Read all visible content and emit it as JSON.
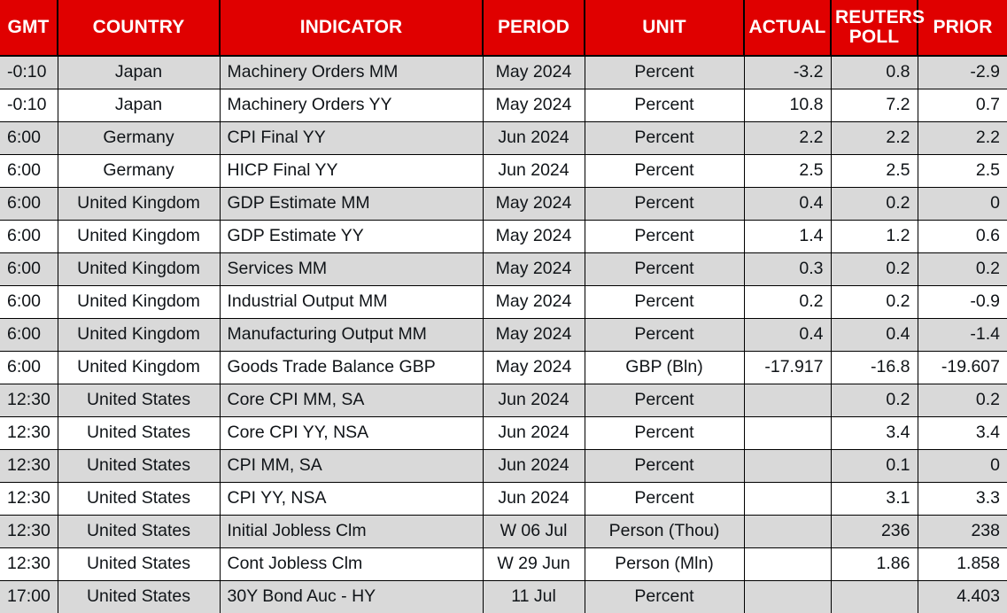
{
  "table": {
    "accent_color": "#e00000",
    "header_text_color": "#ffffff",
    "shaded_row_color": "#d9d9d9",
    "plain_row_color": "#ffffff",
    "columns": [
      {
        "key": "gmt",
        "label": "GMT",
        "align": "left"
      },
      {
        "key": "country",
        "label": "COUNTRY",
        "align": "center"
      },
      {
        "key": "ind",
        "label": "INDICATOR",
        "align": "left"
      },
      {
        "key": "period",
        "label": "PERIOD",
        "align": "center"
      },
      {
        "key": "unit",
        "label": "UNIT",
        "align": "center"
      },
      {
        "key": "actual",
        "label": "ACTUAL",
        "align": "right"
      },
      {
        "key": "poll",
        "label": "REUTERS POLL",
        "align": "right"
      },
      {
        "key": "prior",
        "label": "PRIOR",
        "align": "right"
      }
    ],
    "rows": [
      {
        "gmt": "-0:10",
        "country": "Japan",
        "ind": "Machinery Orders MM",
        "period": "May 2024",
        "unit": "Percent",
        "actual": "-3.2",
        "poll": "0.8",
        "prior": "-2.9"
      },
      {
        "gmt": "-0:10",
        "country": "Japan",
        "ind": "Machinery Orders YY",
        "period": "May 2024",
        "unit": "Percent",
        "actual": "10.8",
        "poll": "7.2",
        "prior": "0.7"
      },
      {
        "gmt": "6:00",
        "country": "Germany",
        "ind": "CPI Final YY",
        "period": "Jun 2024",
        "unit": "Percent",
        "actual": "2.2",
        "poll": "2.2",
        "prior": "2.2"
      },
      {
        "gmt": "6:00",
        "country": "Germany",
        "ind": "HICP Final YY",
        "period": "Jun 2024",
        "unit": "Percent",
        "actual": "2.5",
        "poll": "2.5",
        "prior": "2.5"
      },
      {
        "gmt": "6:00",
        "country": "United Kingdom",
        "ind": "GDP Estimate MM",
        "period": "May 2024",
        "unit": "Percent",
        "actual": "0.4",
        "poll": "0.2",
        "prior": "0"
      },
      {
        "gmt": "6:00",
        "country": "United Kingdom",
        "ind": "GDP Estimate YY",
        "period": "May 2024",
        "unit": "Percent",
        "actual": "1.4",
        "poll": "1.2",
        "prior": "0.6"
      },
      {
        "gmt": "6:00",
        "country": "United Kingdom",
        "ind": "Services MM",
        "period": "May 2024",
        "unit": "Percent",
        "actual": "0.3",
        "poll": "0.2",
        "prior": "0.2"
      },
      {
        "gmt": "6:00",
        "country": "United Kingdom",
        "ind": "Industrial Output MM",
        "period": "May 2024",
        "unit": "Percent",
        "actual": "0.2",
        "poll": "0.2",
        "prior": "-0.9"
      },
      {
        "gmt": "6:00",
        "country": "United Kingdom",
        "ind": "Manufacturing Output MM",
        "period": "May 2024",
        "unit": "Percent",
        "actual": "0.4",
        "poll": "0.4",
        "prior": "-1.4"
      },
      {
        "gmt": "6:00",
        "country": "United Kingdom",
        "ind": "Goods Trade Balance GBP",
        "period": "May 2024",
        "unit": "GBP (Bln)",
        "actual": "-17.917",
        "poll": "-16.8",
        "prior": "-19.607"
      },
      {
        "gmt": "12:30",
        "country": "United States",
        "ind": "Core CPI MM, SA",
        "period": "Jun 2024",
        "unit": "Percent",
        "actual": "",
        "poll": "0.2",
        "prior": "0.2"
      },
      {
        "gmt": "12:30",
        "country": "United States",
        "ind": "Core CPI YY, NSA",
        "period": "Jun 2024",
        "unit": "Percent",
        "actual": "",
        "poll": "3.4",
        "prior": "3.4"
      },
      {
        "gmt": "12:30",
        "country": "United States",
        "ind": "CPI MM, SA",
        "period": "Jun 2024",
        "unit": "Percent",
        "actual": "",
        "poll": "0.1",
        "prior": "0"
      },
      {
        "gmt": "12:30",
        "country": "United States",
        "ind": "CPI YY, NSA",
        "period": "Jun 2024",
        "unit": "Percent",
        "actual": "",
        "poll": "3.1",
        "prior": "3.3"
      },
      {
        "gmt": "12:30",
        "country": "United States",
        "ind": "Initial Jobless Clm",
        "period": "W 06 Jul",
        "unit": "Person (Thou)",
        "actual": "",
        "poll": "236",
        "prior": "238"
      },
      {
        "gmt": "12:30",
        "country": "United States",
        "ind": "Cont Jobless Clm",
        "period": "W 29 Jun",
        "unit": "Person (Mln)",
        "actual": "",
        "poll": "1.86",
        "prior": "1.858"
      },
      {
        "gmt": "17:00",
        "country": "United States",
        "ind": "30Y Bond Auc - HY",
        "period": "11 Jul",
        "unit": "Percent",
        "actual": "",
        "poll": "",
        "prior": "4.403"
      }
    ]
  }
}
